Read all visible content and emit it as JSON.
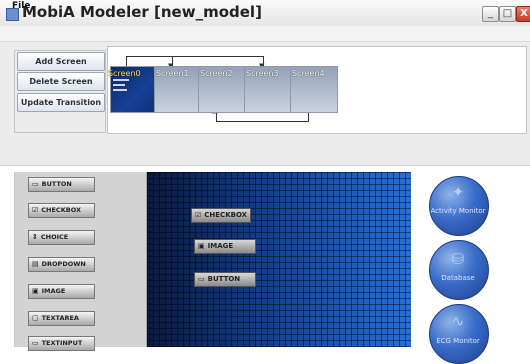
{
  "window": {
    "title": "MobiA Modeler [new_model]",
    "minimize_glyph": "_",
    "maximize_glyph": "□",
    "close_glyph": "X"
  },
  "menu": {
    "file": "File"
  },
  "actions": {
    "add_screen": "Add Screen",
    "delete_screen": "Delete Screen",
    "update_transition": "Update Transition"
  },
  "screens": [
    {
      "label": "Screen0"
    },
    {
      "label": "Screen1"
    },
    {
      "label": "Screen2"
    },
    {
      "label": "Screen3"
    },
    {
      "label": "Screen4"
    }
  ],
  "palette": [
    {
      "label": "BUTTON",
      "icon": "button-icon",
      "glyph": "▭"
    },
    {
      "label": "CHECKBOX",
      "icon": "checkbox-icon",
      "glyph": "☑"
    },
    {
      "label": "CHOICE",
      "icon": "choice-icon",
      "glyph": "⇕"
    },
    {
      "label": "DROPDOWN",
      "icon": "dropdown-icon",
      "glyph": "▤"
    },
    {
      "label": "IMAGE",
      "icon": "image-icon",
      "glyph": "▣"
    },
    {
      "label": "TEXTAREA",
      "icon": "textarea-icon",
      "glyph": "▢"
    },
    {
      "label": "TEXTINPUT",
      "icon": "textinput-icon",
      "glyph": "▭"
    }
  ],
  "canvas_widgets": [
    {
      "label": "CHECKBOX",
      "glyph": "☑"
    },
    {
      "label": "IMAGE",
      "glyph": "▣"
    },
    {
      "label": "BUTTON",
      "glyph": "▭"
    }
  ],
  "services": [
    {
      "label": "Activity Monitor",
      "icon": "runner-icon",
      "glyph": "✦"
    },
    {
      "label": "Database",
      "icon": "database-icon",
      "glyph": "⛁"
    },
    {
      "label": "ECG Monitor",
      "icon": "ecg-icon",
      "glyph": "∿"
    }
  ]
}
